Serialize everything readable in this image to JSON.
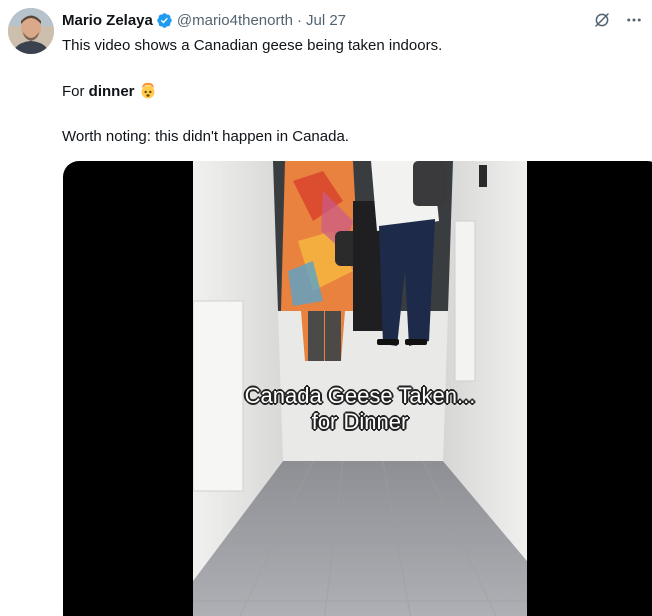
{
  "author": {
    "name": "Mario Zelaya",
    "handle": "@mario4thenorth",
    "separator": "·",
    "date": "Jul 27"
  },
  "icons": {
    "avatar": "avatar",
    "verified": "verified-badge-icon",
    "grok": "grok-icon",
    "more": "more-icon"
  },
  "tweet": {
    "line1": "This video shows a Canadian geese being taken indoors.",
    "line2_prefix": "For ",
    "line2_bold": "dinner",
    "line2_emoji": "exploding-head-emoji",
    "line3": "Worth noting: this didn't happen in Canada."
  },
  "video": {
    "caption_line1": "Canada Geese Taken...",
    "caption_line2": "for Dinner"
  },
  "colors": {
    "verified": "#1d9bf0",
    "muted": "#536471",
    "text": "#0f1419"
  }
}
